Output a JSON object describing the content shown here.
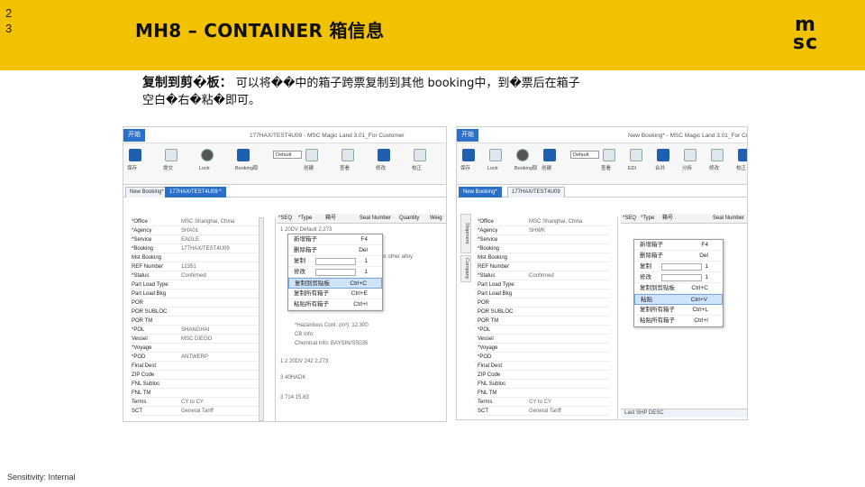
{
  "slide": {
    "number_lines": [
      "2",
      "3"
    ],
    "title": "MH8 – CONTAINER 箱信息",
    "logo_lines": [
      "m",
      "sc"
    ],
    "desc_heading": "复制到剪�板：",
    "desc_line1": "可以将��中的箱子跨票复制到其他 booking中，到�票后在箱子",
    "desc_line2": "空白�右�粘�即可。",
    "sensitivity": "Sensitivity: Internal",
    "brand_color": "#f2c200"
  },
  "left_shot": {
    "window_title": "177HAX/TEST4U09 - MSC Magic Land 3.01_For Customer",
    "start_tab": "开始",
    "ribbon_labels": [
      "保存",
      "提交",
      "Lock",
      "Booking取",
      "创建",
      "查看",
      "修改",
      "校正"
    ],
    "ribbon_dropdown": "Default",
    "doc_tabs": [
      "New Booking*",
      "177HAX/TEST4U09 *"
    ],
    "fields": [
      {
        "k": "*Office",
        "v": "MSC Shanghai, China"
      },
      {
        "k": "*Agency",
        "v": "SHA01"
      },
      {
        "k": "*Service",
        "v": "EAGLE"
      },
      {
        "k": "*Booking",
        "v": "177HAX/TEST4U09"
      },
      {
        "k": "Mst Booking",
        "v": ""
      },
      {
        "k": "REF Number",
        "v": "12351"
      },
      {
        "k": "*Status",
        "v": "Confirmed"
      },
      {
        "k": "Part Load Type",
        "v": ""
      },
      {
        "k": "Part Load Bkg",
        "v": ""
      },
      {
        "k": "POR",
        "v": ""
      },
      {
        "k": "POR SUBLOC",
        "v": ""
      },
      {
        "k": "POR TM",
        "v": ""
      },
      {
        "k": "*POL",
        "v": "SHANGHAI"
      },
      {
        "k": "Vessel",
        "v": "MSC DIEGO"
      },
      {
        "k": "*Voyage",
        "v": ""
      },
      {
        "k": "*POD",
        "v": "ANTWERP"
      },
      {
        "k": "Final Dest",
        "v": ""
      },
      {
        "k": "ZIP Code",
        "v": ""
      },
      {
        "k": "FNL Subloc",
        "v": ""
      },
      {
        "k": "FNL TM",
        "v": ""
      },
      {
        "k": "Terms",
        "v": "CY to CY"
      },
      {
        "k": "SCT",
        "v": "General Tariff"
      }
    ],
    "grid_headers": [
      "*SEQ",
      "*Type",
      "箱号",
      "Seal Number",
      "Quantity",
      "Weig"
    ],
    "grid_lines": [
      "1    20DV              Default       2,273",
      "Eccts or other alloy",
      "*Hazardous Cont: (m³): 12.300",
      "CB Info:",
      "Chemical Info:        BAYSIN/SS035",
      "1    2    20DV                 242      2,273",
      "3    40HADK",
      "3                           714        15.83"
    ],
    "menu": [
      {
        "label": "新增箱子",
        "shortcut": "F4",
        "sel": false
      },
      {
        "label": "删除箱子",
        "shortcut": "Del",
        "sel": false
      },
      {
        "label": "复制",
        "shortcut": "1",
        "sel": false,
        "box": true
      },
      {
        "label": "修改",
        "shortcut": "1",
        "sel": false,
        "box": true
      },
      {
        "label": "复制到剪贴板",
        "shortcut": "Ctrl+C",
        "sel": true
      },
      {
        "label": "复制所有箱子",
        "shortcut": "Ctrl+E",
        "sel": false
      },
      {
        "label": "粘贴所有箱子",
        "shortcut": "Ctrl+I",
        "sel": false
      }
    ]
  },
  "right_shot": {
    "window_title": "New Booking* - MSC Magic Land 3.01_For Customer",
    "start_tab": "开始",
    "ribbon_labels": [
      "保存",
      "Lock",
      "Booking取",
      "创建",
      "查看",
      "EDI",
      "合并",
      "分拆",
      "修改",
      "校正"
    ],
    "ribbon_dropdown": "Default",
    "doc_tabs": [
      "New Booking*",
      "177HAX/TEST4U09"
    ],
    "vtabs": [
      "Shipment",
      "Company"
    ],
    "fields": [
      {
        "k": "*Office",
        "v": "MSC Shanghai, China"
      },
      {
        "k": "*Agency",
        "v": "SHWK"
      },
      {
        "k": "*Service",
        "v": ""
      },
      {
        "k": "*Booking",
        "v": ""
      },
      {
        "k": "Mst Booking",
        "v": ""
      },
      {
        "k": "REF Number",
        "v": ""
      },
      {
        "k": "*Status",
        "v": "Confirmed"
      },
      {
        "k": "Part Load Type",
        "v": ""
      },
      {
        "k": "Part Load Bkg",
        "v": ""
      },
      {
        "k": "POR",
        "v": ""
      },
      {
        "k": "POR SUBLOC",
        "v": ""
      },
      {
        "k": "POR TM",
        "v": ""
      },
      {
        "k": "*POL",
        "v": ""
      },
      {
        "k": "Vessel",
        "v": ""
      },
      {
        "k": "*Voyage",
        "v": ""
      },
      {
        "k": "*POD",
        "v": ""
      },
      {
        "k": "Final Dest",
        "v": ""
      },
      {
        "k": "ZIP Code",
        "v": ""
      },
      {
        "k": "FNL Subloc",
        "v": ""
      },
      {
        "k": "FNL TM",
        "v": ""
      },
      {
        "k": "Terms",
        "v": "CY to CY"
      },
      {
        "k": "SCT",
        "v": "General Tariff"
      }
    ],
    "grid_headers": [
      "*SEQ",
      "*Type",
      "箱号",
      "Seal Number"
    ],
    "menu": [
      {
        "label": "新增箱子",
        "shortcut": "F4",
        "sel": false
      },
      {
        "label": "删除箱子",
        "shortcut": "Del",
        "sel": false
      },
      {
        "label": "复制",
        "shortcut": "1",
        "sel": false,
        "box": true
      },
      {
        "label": "修改",
        "shortcut": "1",
        "sel": false,
        "box": true
      },
      {
        "label": "复制到剪贴板",
        "shortcut": "Ctrl+C",
        "sel": false
      },
      {
        "label": "粘贴",
        "shortcut": "Ctrl+V",
        "sel": true
      },
      {
        "label": "复制所有箱子",
        "shortcut": "Ctrl+L",
        "sel": false
      },
      {
        "label": "粘贴所有箱子",
        "shortcut": "Ctrl+I",
        "sel": false
      }
    ],
    "bottom_bar": "Last SHP DESC"
  }
}
